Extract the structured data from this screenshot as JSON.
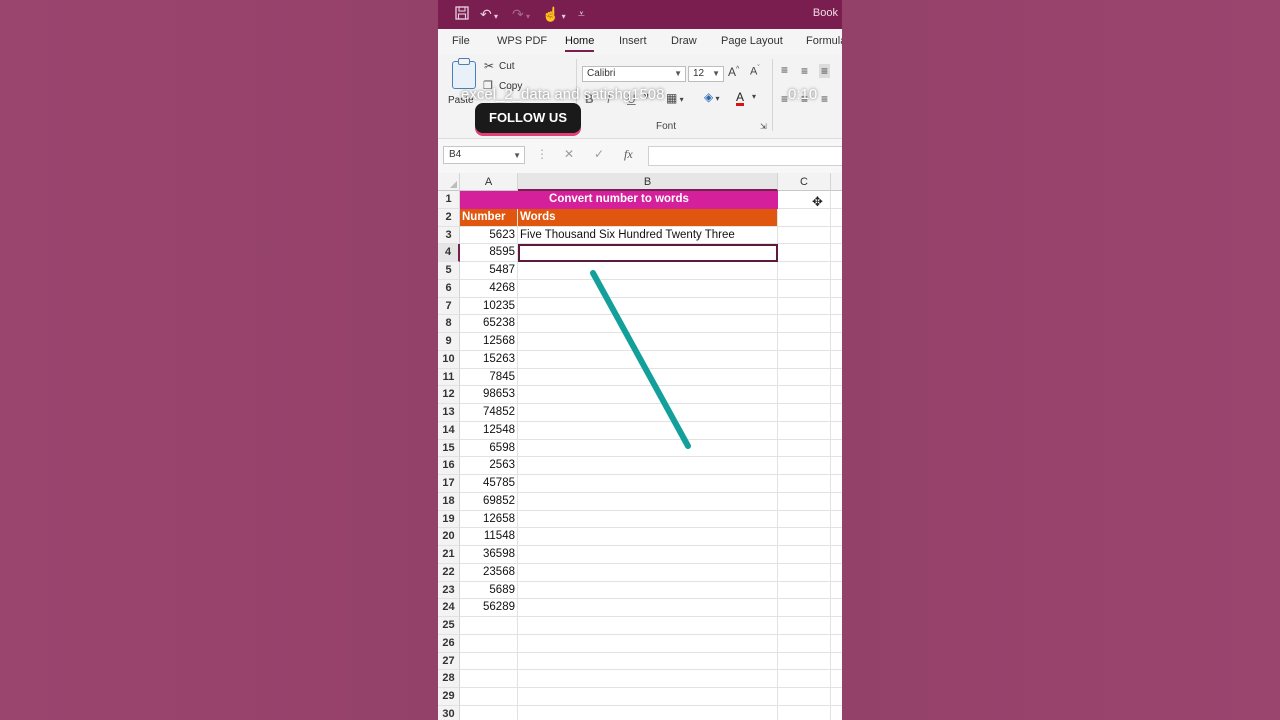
{
  "titlebar": {
    "save_icon": "save-icon",
    "undo_icon": "undo-icon",
    "redo_icon": "redo-icon",
    "touch_icon": "touch-mode-icon",
    "customize_icon": "customize-icon",
    "title": "Book"
  },
  "tabs": [
    "File",
    "WPS PDF",
    "Home",
    "Insert",
    "Draw",
    "Page Layout",
    "Formula"
  ],
  "active_tab": "Home",
  "ribbon": {
    "cut_label": "Cut",
    "copy_label": "Copy",
    "paste_label": "Paste",
    "font_name": "Calibri",
    "font_size": "12",
    "bold": "B",
    "italic": "I",
    "underline": "U",
    "font_group_label": "Font"
  },
  "overlay": {
    "channel_text": "excel_2_data and satishg1508",
    "timer": "0:10",
    "follow_button": "FOLLOW US"
  },
  "formula_bar": {
    "name_box": "B4",
    "cancel": "✕",
    "enter": "✓",
    "fx": "fx",
    "value": ""
  },
  "sheet": {
    "columns": [
      "A",
      "B",
      "C"
    ],
    "title": "Convert number to words",
    "header_number": "Number",
    "header_words": "Words",
    "rows": [
      {
        "row": "3",
        "number": "5623",
        "words": "Five Thousand Six Hundred Twenty Three"
      },
      {
        "row": "4",
        "number": "8595",
        "words": ""
      },
      {
        "row": "5",
        "number": "5487",
        "words": ""
      },
      {
        "row": "6",
        "number": "4268",
        "words": ""
      },
      {
        "row": "7",
        "number": "10235",
        "words": ""
      },
      {
        "row": "8",
        "number": "65238",
        "words": ""
      },
      {
        "row": "9",
        "number": "12568",
        "words": ""
      },
      {
        "row": "10",
        "number": "15263",
        "words": ""
      },
      {
        "row": "11",
        "number": "7845",
        "words": ""
      },
      {
        "row": "12",
        "number": "98653",
        "words": ""
      },
      {
        "row": "13",
        "number": "74852",
        "words": ""
      },
      {
        "row": "14",
        "number": "12548",
        "words": ""
      },
      {
        "row": "15",
        "number": "6598",
        "words": ""
      },
      {
        "row": "16",
        "number": "2563",
        "words": ""
      },
      {
        "row": "17",
        "number": "45785",
        "words": ""
      },
      {
        "row": "18",
        "number": "69852",
        "words": ""
      },
      {
        "row": "19",
        "number": "12658",
        "words": ""
      },
      {
        "row": "20",
        "number": "11548",
        "words": ""
      },
      {
        "row": "21",
        "number": "36598",
        "words": ""
      },
      {
        "row": "22",
        "number": "23568",
        "words": ""
      },
      {
        "row": "23",
        "number": "5689",
        "words": ""
      },
      {
        "row": "24",
        "number": "56289",
        "words": ""
      },
      {
        "row": "25",
        "number": "",
        "words": ""
      },
      {
        "row": "26",
        "number": "",
        "words": ""
      },
      {
        "row": "27",
        "number": "",
        "words": ""
      },
      {
        "row": "28",
        "number": "",
        "words": ""
      },
      {
        "row": "29",
        "number": "",
        "words": ""
      },
      {
        "row": "30",
        "number": "",
        "words": ""
      }
    ],
    "active_row": "4"
  },
  "colors": {
    "title_fill": "#d4219b",
    "header_fill": "#e0560f",
    "titlebar": "#7a1e4f",
    "pen_stroke": "#13a09a",
    "background": "#96436b"
  }
}
